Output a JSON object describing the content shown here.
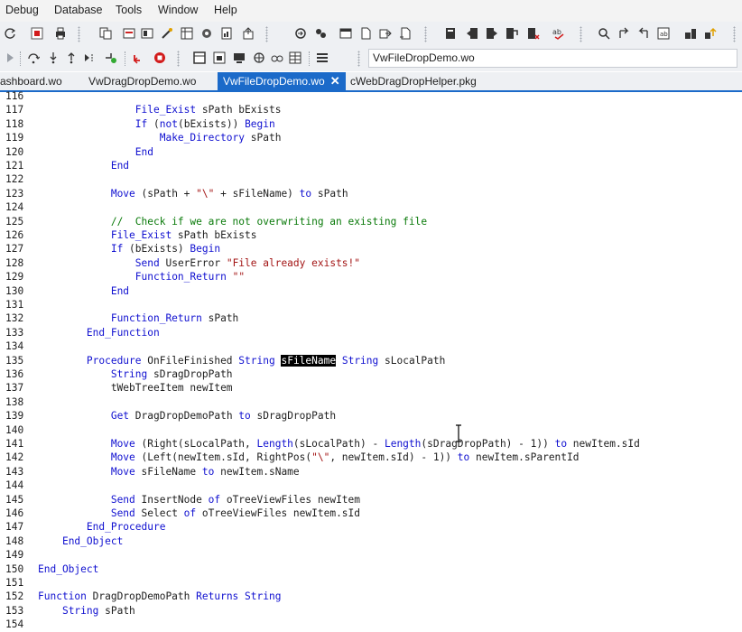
{
  "menu": [
    "Debug",
    "Database",
    "Tools",
    "Window",
    "Help"
  ],
  "toolbar": {
    "workspace_combo_value": "VwFileDropDemo.wo"
  },
  "tabs": [
    {
      "label": "ashboard.wo",
      "active": false
    },
    {
      "label": "VwDragDropDemo.wo",
      "active": false
    },
    {
      "label": "VwFileDropDemo.wo",
      "active": true
    },
    {
      "label": "cWebDragDropHelper.pkg",
      "active": false
    }
  ],
  "colors": {
    "accent": "#1b6ac9",
    "keyword": "#1010d0",
    "string": "#a31515",
    "comment": "#0a7a0a"
  },
  "code": [
    {
      "n": "116",
      "t": ""
    },
    {
      "n": "117",
      "t": "                File_Exist sPath bExists"
    },
    {
      "n": "118",
      "t": "                If (not(bExists)) Begin"
    },
    {
      "n": "119",
      "t": "                    Make_Directory sPath"
    },
    {
      "n": "120",
      "t": "                End"
    },
    {
      "n": "121",
      "t": "            End"
    },
    {
      "n": "122",
      "t": ""
    },
    {
      "n": "123",
      "t": "            Move (sPath + \"\\\" + sFileName) to sPath"
    },
    {
      "n": "124",
      "t": ""
    },
    {
      "n": "125",
      "t": "            //  Check if we are not overwriting an existing file"
    },
    {
      "n": "126",
      "t": "            File_Exist sPath bExists"
    },
    {
      "n": "127",
      "t": "            If (bExists) Begin"
    },
    {
      "n": "128",
      "t": "                Send UserError \"File already exists!\""
    },
    {
      "n": "129",
      "t": "                Function_Return \"\""
    },
    {
      "n": "130",
      "t": "            End"
    },
    {
      "n": "131",
      "t": ""
    },
    {
      "n": "132",
      "t": "            Function_Return sPath"
    },
    {
      "n": "133",
      "t": "        End_Function"
    },
    {
      "n": "134",
      "t": ""
    },
    {
      "n": "135",
      "t": "        Procedure OnFileFinished String sFileName String sLocalPath"
    },
    {
      "n": "136",
      "t": "            String sDragDropPath"
    },
    {
      "n": "137",
      "t": "            tWebTreeItem newItem"
    },
    {
      "n": "138",
      "t": ""
    },
    {
      "n": "139",
      "t": "            Get DragDropDemoPath to sDragDropPath"
    },
    {
      "n": "140",
      "t": ""
    },
    {
      "n": "141",
      "t": "            Move (Right(sLocalPath, Length(sLocalPath) - Length(sDragDropPath) - 1)) to newItem.sId"
    },
    {
      "n": "142",
      "t": "            Move (Left(newItem.sId, RightPos(\"\\\", newItem.sId) - 1)) to newItem.sParentId"
    },
    {
      "n": "143",
      "t": "            Move sFileName to newItem.sName"
    },
    {
      "n": "144",
      "t": ""
    },
    {
      "n": "145",
      "t": "            Send InsertNode of oTreeViewFiles newItem"
    },
    {
      "n": "146",
      "t": "            Send Select of oTreeViewFiles newItem.sId"
    },
    {
      "n": "147",
      "t": "        End_Procedure"
    },
    {
      "n": "148",
      "t": "    End_Object"
    },
    {
      "n": "149",
      "t": ""
    },
    {
      "n": "150",
      "t": "End_Object"
    },
    {
      "n": "151",
      "t": ""
    },
    {
      "n": "152",
      "t": "Function DragDropDemoPath Returns String"
    },
    {
      "n": "153",
      "t": "    String sPath"
    },
    {
      "n": "154",
      "t": ""
    }
  ]
}
